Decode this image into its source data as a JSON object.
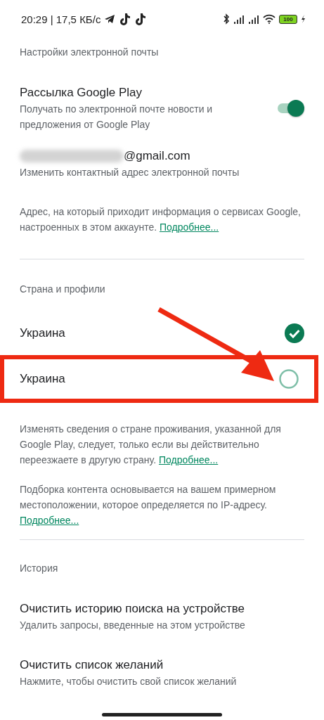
{
  "status_bar": {
    "time": "20:29 | 17,5 КБ/с",
    "battery": "100"
  },
  "email_section": {
    "header": "Настройки электронной почты",
    "newsletter": {
      "title": "Рассылка Google Play",
      "subtitle": "Получать по электронной почте новости и предложения от Google Play",
      "on": true
    },
    "email": {
      "address": "@gmail.com",
      "subtitle": "Изменить контактный адрес электронной почты"
    },
    "info": {
      "text": "Адрес, на который приходит информация о сервисах Google, настроенных в этом аккаунте. ",
      "link": "Подробнее..."
    }
  },
  "country_section": {
    "header": "Страна и профили",
    "countries": [
      {
        "name": "Украина",
        "selected": true,
        "highlighted": false
      },
      {
        "name": "Украина",
        "selected": false,
        "highlighted": true
      }
    ],
    "notes": [
      {
        "text": "Изменять сведения о стране проживания, указанной для Google Play, следует, только если вы действительно переезжаете в другую страну. ",
        "link": "Подробнее..."
      },
      {
        "text": "Подборка контента основывается на вашем примерном местоположении, которое определяется по IP-адресу. ",
        "link": "Подробнее..."
      }
    ]
  },
  "history_section": {
    "header": "История",
    "items": [
      {
        "title": "Очистить историю поиска на устройстве",
        "subtitle": "Удалить запросы, введенные на этом устройстве"
      },
      {
        "title": "Очистить список желаний",
        "subtitle": "Нажмите, чтобы очистить свой список желаний"
      }
    ]
  }
}
